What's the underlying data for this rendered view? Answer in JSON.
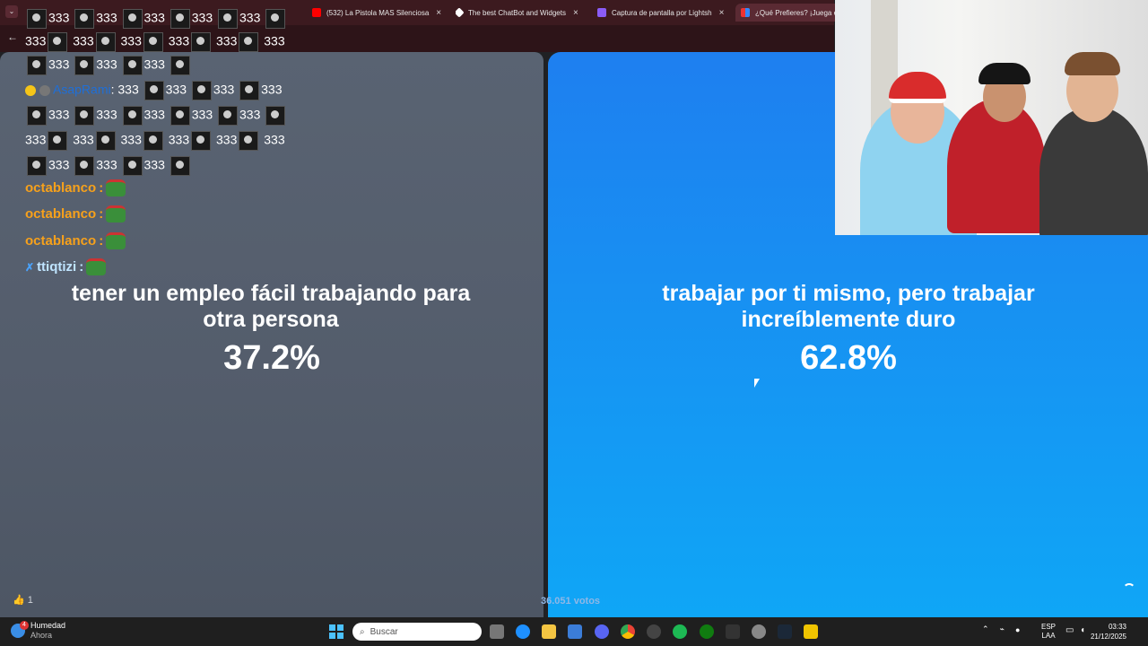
{
  "browser": {
    "tabs": [
      {
        "title": "(532) La Pistola MAS Silenciosa",
        "icon": "youtube-icon",
        "color": "#ff0000"
      },
      {
        "title": "The best ChatBot and Widgets",
        "icon": "streamelements-icon",
        "color": "#ffffff"
      },
      {
        "title": "Captura de pantalla por Lightsh",
        "icon": "lightshot-icon",
        "color": "#8a5cf6"
      },
      {
        "title": "¿Qué Prefieres? ¡Juega en",
        "icon": "either-icon",
        "color": "#4a90e2"
      }
    ]
  },
  "chat": {
    "emote_text": "333",
    "lines": [
      {
        "user": "AsapRami",
        "message": "333"
      },
      {
        "user": "octablanco"
      },
      {
        "user": "octablanco"
      },
      {
        "user": "octablanco"
      },
      {
        "user": "ttiqtizi"
      }
    ]
  },
  "poll": {
    "option_a": {
      "text": "tener un empleo fácil trabajando para otra persona",
      "percent": "37.2%"
    },
    "option_b": {
      "text": "trabajar por ti mismo, pero trabajar increíblemente duro",
      "percent": "62.8%"
    },
    "votes": "36.051 votos",
    "likes": "1"
  },
  "taskbar": {
    "weather_label": "Humedad",
    "weather_sub": "Ahora",
    "weather_badge": "4",
    "search_placeholder": "Buscar",
    "lang_top": "ESP",
    "lang_bottom": "LAA",
    "time": "03:33",
    "date": "21/12/2025"
  },
  "colors": {
    "left_panel": "#576170",
    "right_panel": "#1592f3",
    "orange_name": "#f7a11b"
  }
}
